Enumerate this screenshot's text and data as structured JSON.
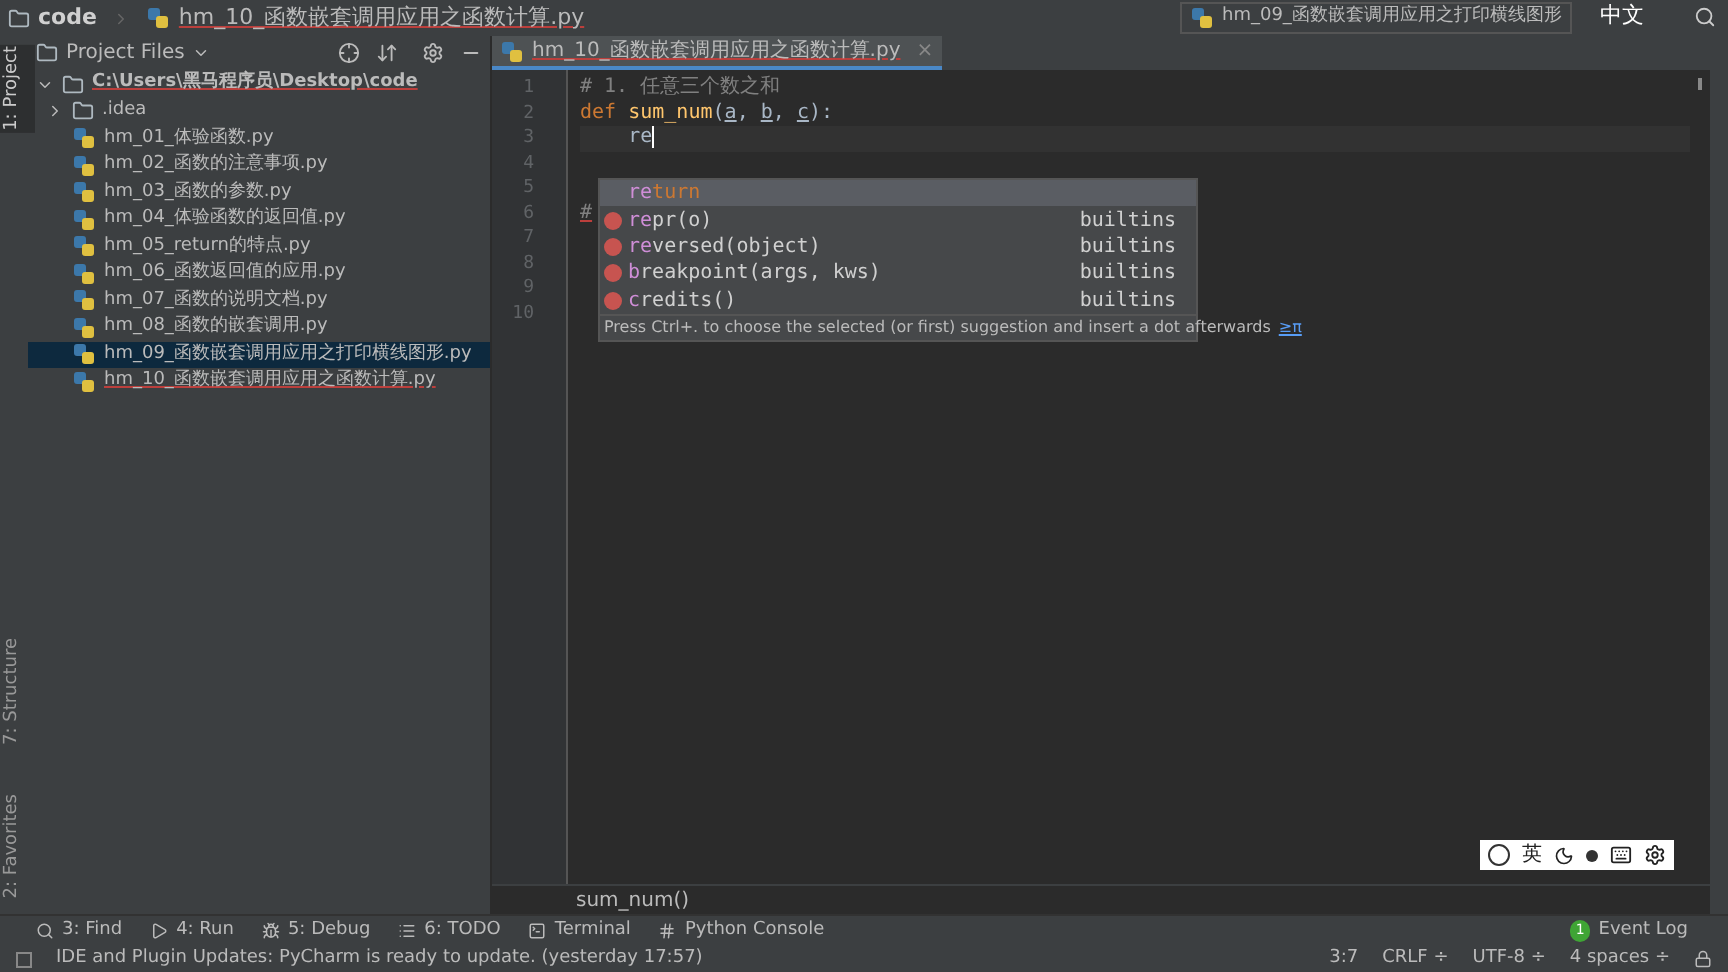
{
  "nav_bar": {
    "folder": "code",
    "file": "hm_10_函数嵌套调用应用之函数计算.py"
  },
  "recent_file": "hm_09_函数嵌套调用应用之打印横线图形",
  "ime_overlay": "中文",
  "left_strip": [
    {
      "label": "1: Project",
      "selected": true
    },
    {
      "label": "7: Structure",
      "selected": false
    },
    {
      "label": "2: Favorites",
      "selected": false
    }
  ],
  "project_panel": {
    "title": "Project Files",
    "root": {
      "label": "C:\\Users\\黑马程序员\\Desktop\\code",
      "expanded": true,
      "children": [
        {
          "label": ".idea",
          "kind": "folder",
          "expanded": false,
          "selected": false,
          "error": false
        },
        {
          "label": "hm_01_体验函数.py",
          "kind": "file",
          "selected": false,
          "error": false
        },
        {
          "label": "hm_02_函数的注意事项.py",
          "kind": "file",
          "selected": false,
          "error": false
        },
        {
          "label": "hm_03_函数的参数.py",
          "kind": "file",
          "selected": false,
          "error": false
        },
        {
          "label": "hm_04_体验函数的返回值.py",
          "kind": "file",
          "selected": false,
          "error": false
        },
        {
          "label": "hm_05_return的特点.py",
          "kind": "file",
          "selected": false,
          "error": false
        },
        {
          "label": "hm_06_函数返回值的应用.py",
          "kind": "file",
          "selected": false,
          "error": false
        },
        {
          "label": "hm_07_函数的说明文档.py",
          "kind": "file",
          "selected": false,
          "error": false
        },
        {
          "label": "hm_08_函数的嵌套调用.py",
          "kind": "file",
          "selected": false,
          "error": false
        },
        {
          "label": "hm_09_函数嵌套调用应用之打印横线图形.py",
          "kind": "file",
          "selected": true,
          "error": false
        },
        {
          "label": "hm_10_函数嵌套调用应用之函数计算.py",
          "kind": "file",
          "selected": false,
          "error": true
        }
      ]
    }
  },
  "editor_tabs": [
    {
      "label": "hm_10_函数嵌套调用应用之函数计算.py",
      "close": "×",
      "selected": true
    }
  ],
  "code_lines": [
    {
      "number": "1",
      "tokens": [
        {
          "text": "# 1. 任意三个数之和",
          "kind": "comment"
        }
      ]
    },
    {
      "number": "2",
      "tokens": [
        {
          "text": "def ",
          "kind": "keyword"
        },
        {
          "text": "sum_num",
          "kind": "function"
        },
        {
          "text": "(",
          "kind": "plain"
        },
        {
          "text": "a",
          "kind": "param"
        },
        {
          "text": ", ",
          "kind": "plain"
        },
        {
          "text": "b",
          "kind": "param"
        },
        {
          "text": ", ",
          "kind": "plain"
        },
        {
          "text": "c",
          "kind": "param"
        },
        {
          "text": "):",
          "kind": "plain"
        }
      ]
    },
    {
      "number": "3",
      "tokens": [
        {
          "text": "    re",
          "kind": "plain"
        }
      ]
    },
    {
      "number": "4"
    },
    {
      "number": "5"
    },
    {
      "number": "6",
      "tokens": [
        {
          "text": "#",
          "kind": "error"
        }
      ]
    },
    {
      "number": "7"
    },
    {
      "number": "8"
    },
    {
      "number": "9"
    },
    {
      "number": "10"
    }
  ],
  "completion": {
    "items": [
      {
        "match": "re",
        "rest": "turn",
        "kind": "keyword",
        "selected": true
      },
      {
        "match": "re",
        "rest": "pr(o)",
        "source": "builtins",
        "kind": "function",
        "selected": false
      },
      {
        "match": "re",
        "rest": "versed(object)",
        "source": "builtins",
        "kind": "function",
        "selected": false
      },
      {
        "match": "b",
        "rest": "reakpoint(args, kws)",
        "source": "builtins",
        "kind": "function",
        "selected": false
      },
      {
        "match": "c",
        "rest": "redits()",
        "source": "builtins",
        "kind": "function",
        "selected": false
      }
    ],
    "hint": "Press Ctrl+. to choose the selected (or first) suggestion and insert a dot afterwards",
    "hint_link": "≥π"
  },
  "breadcrumb": "sum_num()",
  "ime_toolbar": {
    "language": "英"
  },
  "tool_windows": [
    {
      "label": "3: Find"
    },
    {
      "label": "4: Run"
    },
    {
      "label": "5: Debug"
    },
    {
      "label": "6: TODO"
    },
    {
      "label": "Terminal"
    },
    {
      "label": "Python Console"
    }
  ],
  "event_log": {
    "count": "1",
    "label": "Event Log"
  },
  "status_bar": {
    "message": "IDE and Plugin Updates: PyCharm is ready to update. (yesterday 17:57)",
    "position": "3:7",
    "line_ending": "CRLF ÷",
    "encoding": "UTF-8 ÷",
    "indent": "4 spaces ÷"
  }
}
